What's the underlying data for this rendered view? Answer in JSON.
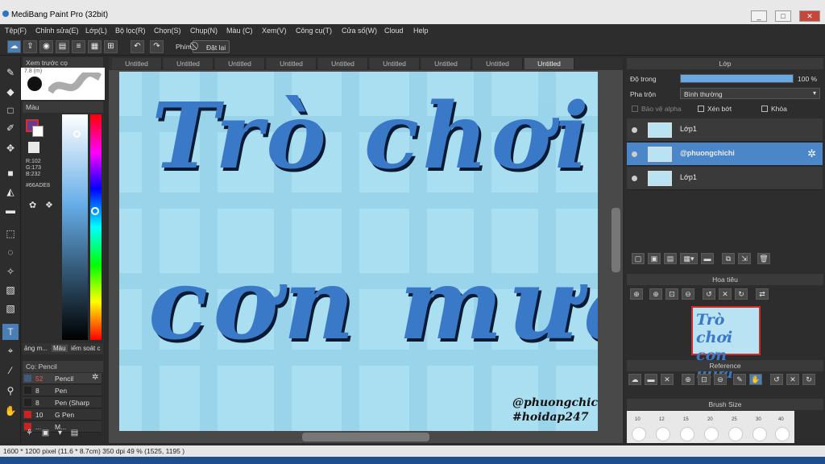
{
  "window": {
    "title": "MediBang Paint Pro (32bit)",
    "minimize": "_",
    "maximize": "□",
    "close": "✕"
  },
  "menu": [
    "Tệp(F)",
    "Chỉnh sửa(E)",
    "Lớp(L)",
    "Bộ lọc(R)",
    "Chọn(S)",
    "Chụp(N)",
    "Màu (C)",
    "Xem(V)",
    "Công cụ(T)",
    "Cửa số(W)",
    "Cloud",
    "Help"
  ],
  "toolbar": {
    "phim_label": "Phím",
    "reset_label": "Đặt lại"
  },
  "preview_panel": {
    "title": "Xem trước cọ",
    "size_label": "7.8 (m)"
  },
  "color_panel": {
    "title": "Màu",
    "r": "R:102",
    "g": "G:173",
    "b": "B:232",
    "hex": "#66ADE8",
    "tabs": [
      "ảng m...",
      "Màu",
      "iếm soát c"
    ],
    "fg_color": "#d0303a",
    "bg_color": "#ffffff"
  },
  "brush_panel": {
    "title": "Cọ: Pencil",
    "items": [
      {
        "size": "52",
        "name": "Pencil",
        "color": "#3f5a7a"
      },
      {
        "size": "8",
        "name": "Pen",
        "color": "#222222"
      },
      {
        "size": "8",
        "name": "Pen (Sharp",
        "color": "#222222"
      },
      {
        "size": "10",
        "name": "G Pen",
        "color": "#cc2222"
      },
      {
        "size": "...",
        "name": "M...",
        "color": "#cc2222"
      }
    ]
  },
  "canvas_tabs": [
    "Untitled",
    "Untitled",
    "Untitled",
    "Untitled",
    "Untitled",
    "Untitled",
    "Untitled",
    "Untitled",
    "Untitled"
  ],
  "canvas": {
    "line1": "Trò chơi",
    "line2": "cơn mưa",
    "watermark1": "@phuongchichi",
    "watermark2": "#hoidap247",
    "bg_color": "#a9dff0",
    "letter_color": "#3a78c8"
  },
  "layer_panel": {
    "title": "Lớp",
    "opacity_label": "Độ trong",
    "opacity_value": "100 %",
    "opacity_fraction": 1.0,
    "blend_label": "Pha trộn",
    "blend_value": "Bình thường",
    "protect_alpha": "Bảo vệ alpha",
    "clip": "Xén bớt",
    "lock": "Khóa",
    "layers": [
      {
        "name": "Lớp1",
        "selected": false
      },
      {
        "name": "@phuongchichi",
        "selected": true
      },
      {
        "name": "Lớp1",
        "selected": false
      }
    ]
  },
  "navigator": {
    "title": "Hoa tiêu"
  },
  "reference": {
    "title": "Reference"
  },
  "brush_size": {
    "title": "Brush Size",
    "labels": [
      "10",
      "12",
      "15",
      "20",
      "25",
      "30",
      "40"
    ]
  },
  "status": {
    "text": "1600 * 1200 pixel  (11.6 * 8.7cm)  350 dpi  49 %  (1525, 1195 )"
  }
}
